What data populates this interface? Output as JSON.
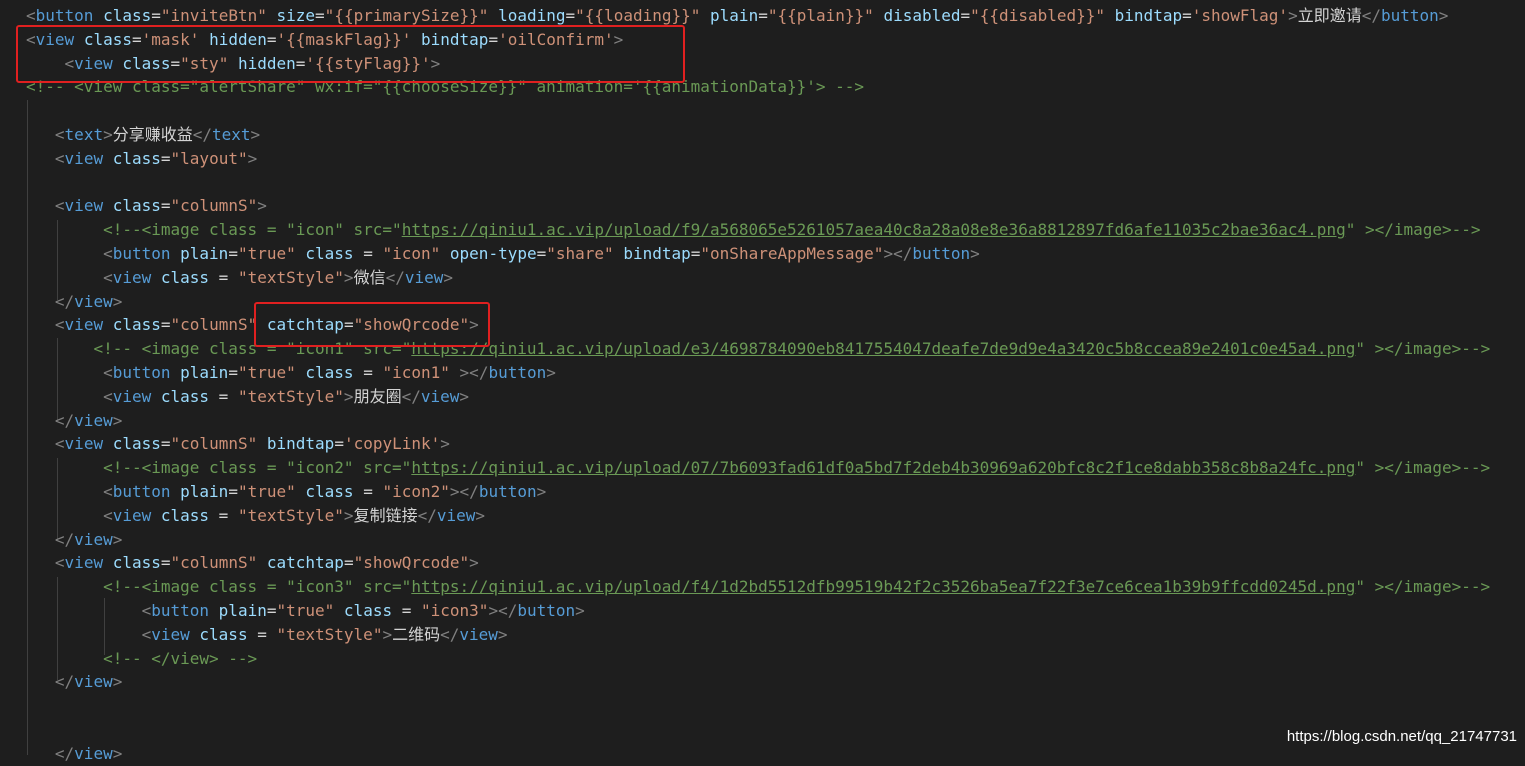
{
  "editor": {
    "theme": "dark",
    "background": "#1e1e1e",
    "lines": [
      [
        [
          "t-pun",
          "<"
        ],
        [
          "t-tag",
          "button"
        ],
        [
          "t-txt",
          " "
        ],
        [
          "t-attr",
          "class"
        ],
        [
          "t-txt",
          "="
        ],
        [
          "t-str",
          "\"inviteBtn\""
        ],
        [
          "t-txt",
          " "
        ],
        [
          "t-attr",
          "size"
        ],
        [
          "t-txt",
          "="
        ],
        [
          "t-str",
          "\"{{primarySize}}\""
        ],
        [
          "t-txt",
          " "
        ],
        [
          "t-attr",
          "loading"
        ],
        [
          "t-txt",
          "="
        ],
        [
          "t-str",
          "\"{{loading}}\""
        ],
        [
          "t-txt",
          " "
        ],
        [
          "t-attr",
          "plain"
        ],
        [
          "t-txt",
          "="
        ],
        [
          "t-str",
          "\"{{plain}}\""
        ],
        [
          "t-txt",
          " "
        ],
        [
          "t-attr",
          "disabled"
        ],
        [
          "t-txt",
          "="
        ],
        [
          "t-str",
          "\"{{disabled}}\""
        ],
        [
          "t-txt",
          " "
        ],
        [
          "t-attr",
          "bindtap"
        ],
        [
          "t-txt",
          "="
        ],
        [
          "t-str",
          "'showFlag'"
        ],
        [
          "t-pun",
          ">"
        ],
        [
          "t-txt",
          "立即邀请"
        ],
        [
          "t-pun",
          "</"
        ],
        [
          "t-tag",
          "button"
        ],
        [
          "t-pun",
          ">"
        ]
      ],
      [
        [
          "t-pun",
          "<"
        ],
        [
          "t-tag",
          "view"
        ],
        [
          "t-txt",
          " "
        ],
        [
          "t-attr",
          "class"
        ],
        [
          "t-txt",
          "="
        ],
        [
          "t-str",
          "'mask'"
        ],
        [
          "t-txt",
          " "
        ],
        [
          "t-attr",
          "hidden"
        ],
        [
          "t-txt",
          "="
        ],
        [
          "t-str",
          "'{{maskFlag}}'"
        ],
        [
          "t-txt",
          " "
        ],
        [
          "t-attr",
          "bindtap"
        ],
        [
          "t-txt",
          "="
        ],
        [
          "t-str",
          "'oilConfirm'"
        ],
        [
          "t-pun",
          ">"
        ]
      ],
      [
        [
          "t-txt",
          "    "
        ],
        [
          "t-pun",
          "<"
        ],
        [
          "t-tag",
          "view"
        ],
        [
          "t-txt",
          " "
        ],
        [
          "t-attr",
          "class"
        ],
        [
          "t-txt",
          "="
        ],
        [
          "t-str",
          "\"sty\""
        ],
        [
          "t-txt",
          " "
        ],
        [
          "t-attr",
          "hidden"
        ],
        [
          "t-txt",
          "="
        ],
        [
          "t-str",
          "'{{styFlag}}'"
        ],
        [
          "t-pun",
          ">"
        ]
      ],
      [
        [
          "t-cm",
          "<!-- <view class=\"alertShare\" wx:if=\"{{chooseSize}}\" animation='{{animationData}}'> -->"
        ]
      ],
      [],
      [
        [
          "t-txt",
          "   "
        ],
        [
          "t-pun",
          "<"
        ],
        [
          "t-tag",
          "text"
        ],
        [
          "t-pun",
          ">"
        ],
        [
          "t-txt",
          "分享赚收益"
        ],
        [
          "t-pun",
          "</"
        ],
        [
          "t-tag",
          "text"
        ],
        [
          "t-pun",
          ">"
        ]
      ],
      [
        [
          "t-txt",
          "   "
        ],
        [
          "t-pun",
          "<"
        ],
        [
          "t-tag",
          "view"
        ],
        [
          "t-txt",
          " "
        ],
        [
          "t-attr",
          "class"
        ],
        [
          "t-txt",
          "="
        ],
        [
          "t-str",
          "\"layout\""
        ],
        [
          "t-pun",
          ">"
        ]
      ],
      [],
      [
        [
          "t-txt",
          "   "
        ],
        [
          "t-pun",
          "<"
        ],
        [
          "t-tag",
          "view"
        ],
        [
          "t-txt",
          " "
        ],
        [
          "t-attr",
          "class"
        ],
        [
          "t-txt",
          "="
        ],
        [
          "t-str",
          "\"columnS\""
        ],
        [
          "t-pun",
          ">"
        ]
      ],
      [
        [
          "t-txt",
          "        "
        ],
        [
          "t-cm",
          "<!--<image class = \"icon\" src=\""
        ],
        [
          "t-cm-url",
          "https://qiniu1.ac.vip/upload/f9/a568065e5261057aea40c8a28a08e8e36a8812897fd6afe11035c2bae36ac4.png"
        ],
        [
          "t-cm",
          "\" ></image>-->"
        ]
      ],
      [
        [
          "t-txt",
          "        "
        ],
        [
          "t-pun",
          "<"
        ],
        [
          "t-tag",
          "button"
        ],
        [
          "t-txt",
          " "
        ],
        [
          "t-attr",
          "plain"
        ],
        [
          "t-txt",
          "="
        ],
        [
          "t-str",
          "\"true\""
        ],
        [
          "t-txt",
          " "
        ],
        [
          "t-attr",
          "class"
        ],
        [
          "t-txt",
          " = "
        ],
        [
          "t-str",
          "\"icon\""
        ],
        [
          "t-txt",
          " "
        ],
        [
          "t-attr",
          "open-type"
        ],
        [
          "t-txt",
          "="
        ],
        [
          "t-str",
          "\"share\""
        ],
        [
          "t-txt",
          " "
        ],
        [
          "t-attr",
          "bindtap"
        ],
        [
          "t-txt",
          "="
        ],
        [
          "t-str",
          "\"onShareAppMessage\""
        ],
        [
          "t-pun",
          "></"
        ],
        [
          "t-tag",
          "button"
        ],
        [
          "t-pun",
          ">"
        ]
      ],
      [
        [
          "t-txt",
          "        "
        ],
        [
          "t-pun",
          "<"
        ],
        [
          "t-tag",
          "view"
        ],
        [
          "t-txt",
          " "
        ],
        [
          "t-attr",
          "class"
        ],
        [
          "t-txt",
          " = "
        ],
        [
          "t-str",
          "\"textStyle\""
        ],
        [
          "t-pun",
          ">"
        ],
        [
          "t-txt",
          "微信"
        ],
        [
          "t-pun",
          "</"
        ],
        [
          "t-tag",
          "view"
        ],
        [
          "t-pun",
          ">"
        ]
      ],
      [
        [
          "t-txt",
          "   "
        ],
        [
          "t-pun",
          "</"
        ],
        [
          "t-tag",
          "view"
        ],
        [
          "t-pun",
          ">"
        ]
      ],
      [
        [
          "t-txt",
          "   "
        ],
        [
          "t-pun",
          "<"
        ],
        [
          "t-tag",
          "view"
        ],
        [
          "t-txt",
          " "
        ],
        [
          "t-attr",
          "class"
        ],
        [
          "t-txt",
          "="
        ],
        [
          "t-str",
          "\"columnS\""
        ],
        [
          "t-txt",
          " "
        ],
        [
          "t-attr",
          "catchtap"
        ],
        [
          "t-txt",
          "="
        ],
        [
          "t-str",
          "\"showQrcode\""
        ],
        [
          "t-pun",
          ">"
        ]
      ],
      [
        [
          "t-txt",
          "       "
        ],
        [
          "t-cm",
          "<!-- <image class = \"icon1\" src=\""
        ],
        [
          "t-cm-url",
          "https://qiniu1.ac.vip/upload/e3/4698784090eb8417554047deafe7de9d9e4a3420c5b8ccea89e2401c0e45a4.png"
        ],
        [
          "t-cm",
          "\" ></image>-->"
        ]
      ],
      [
        [
          "t-txt",
          "        "
        ],
        [
          "t-pun",
          "<"
        ],
        [
          "t-tag",
          "button"
        ],
        [
          "t-txt",
          " "
        ],
        [
          "t-attr",
          "plain"
        ],
        [
          "t-txt",
          "="
        ],
        [
          "t-str",
          "\"true\""
        ],
        [
          "t-txt",
          " "
        ],
        [
          "t-attr",
          "class"
        ],
        [
          "t-txt",
          " = "
        ],
        [
          "t-str",
          "\"icon1\""
        ],
        [
          "t-txt",
          " "
        ],
        [
          "t-pun",
          "></"
        ],
        [
          "t-tag",
          "button"
        ],
        [
          "t-pun",
          ">"
        ]
      ],
      [
        [
          "t-txt",
          "        "
        ],
        [
          "t-pun",
          "<"
        ],
        [
          "t-tag",
          "view"
        ],
        [
          "t-txt",
          " "
        ],
        [
          "t-attr",
          "class"
        ],
        [
          "t-txt",
          " = "
        ],
        [
          "t-str",
          "\"textStyle\""
        ],
        [
          "t-pun",
          ">"
        ],
        [
          "t-txt",
          "朋友圈"
        ],
        [
          "t-pun",
          "</"
        ],
        [
          "t-tag",
          "view"
        ],
        [
          "t-pun",
          ">"
        ]
      ],
      [
        [
          "t-txt",
          "   "
        ],
        [
          "t-pun",
          "</"
        ],
        [
          "t-tag",
          "view"
        ],
        [
          "t-pun",
          ">"
        ]
      ],
      [
        [
          "t-txt",
          "   "
        ],
        [
          "t-pun",
          "<"
        ],
        [
          "t-tag",
          "view"
        ],
        [
          "t-txt",
          " "
        ],
        [
          "t-attr",
          "class"
        ],
        [
          "t-txt",
          "="
        ],
        [
          "t-str",
          "\"columnS\""
        ],
        [
          "t-txt",
          " "
        ],
        [
          "t-attr",
          "bindtap"
        ],
        [
          "t-txt",
          "="
        ],
        [
          "t-str",
          "'copyLink'"
        ],
        [
          "t-pun",
          ">"
        ]
      ],
      [
        [
          "t-txt",
          "        "
        ],
        [
          "t-cm",
          "<!--<image class = \"icon2\" src=\""
        ],
        [
          "t-cm-url",
          "https://qiniu1.ac.vip/upload/07/7b6093fad61df0a5bd7f2deb4b30969a620bfc8c2f1ce8dabb358c8b8a24fc.png"
        ],
        [
          "t-cm",
          "\" ></image>-->"
        ]
      ],
      [
        [
          "t-txt",
          "        "
        ],
        [
          "t-pun",
          "<"
        ],
        [
          "t-tag",
          "button"
        ],
        [
          "t-txt",
          " "
        ],
        [
          "t-attr",
          "plain"
        ],
        [
          "t-txt",
          "="
        ],
        [
          "t-str",
          "\"true\""
        ],
        [
          "t-txt",
          " "
        ],
        [
          "t-attr",
          "class"
        ],
        [
          "t-txt",
          " = "
        ],
        [
          "t-str",
          "\"icon2\""
        ],
        [
          "t-pun",
          "></"
        ],
        [
          "t-tag",
          "button"
        ],
        [
          "t-pun",
          ">"
        ]
      ],
      [
        [
          "t-txt",
          "        "
        ],
        [
          "t-pun",
          "<"
        ],
        [
          "t-tag",
          "view"
        ],
        [
          "t-txt",
          " "
        ],
        [
          "t-attr",
          "class"
        ],
        [
          "t-txt",
          " = "
        ],
        [
          "t-str",
          "\"textStyle\""
        ],
        [
          "t-pun",
          ">"
        ],
        [
          "t-txt",
          "复制链接"
        ],
        [
          "t-pun",
          "</"
        ],
        [
          "t-tag",
          "view"
        ],
        [
          "t-pun",
          ">"
        ]
      ],
      [
        [
          "t-txt",
          "   "
        ],
        [
          "t-pun",
          "</"
        ],
        [
          "t-tag",
          "view"
        ],
        [
          "t-pun",
          ">"
        ]
      ],
      [
        [
          "t-txt",
          "   "
        ],
        [
          "t-pun",
          "<"
        ],
        [
          "t-tag",
          "view"
        ],
        [
          "t-txt",
          " "
        ],
        [
          "t-attr",
          "class"
        ],
        [
          "t-txt",
          "="
        ],
        [
          "t-str",
          "\"columnS\""
        ],
        [
          "t-txt",
          " "
        ],
        [
          "t-attr",
          "catchtap"
        ],
        [
          "t-txt",
          "="
        ],
        [
          "t-str",
          "\"showQrcode\""
        ],
        [
          "t-pun",
          ">"
        ]
      ],
      [
        [
          "t-txt",
          "        "
        ],
        [
          "t-cm",
          "<!--<image class = \"icon3\" src=\""
        ],
        [
          "t-cm-url",
          "https://qiniu1.ac.vip/upload/f4/1d2bd5512dfb99519b42f2c3526ba5ea7f22f3e7ce6cea1b39b9ffcdd0245d.png"
        ],
        [
          "t-cm",
          "\" ></image>-->"
        ]
      ],
      [
        [
          "t-txt",
          "            "
        ],
        [
          "t-pun",
          "<"
        ],
        [
          "t-tag",
          "button"
        ],
        [
          "t-txt",
          " "
        ],
        [
          "t-attr",
          "plain"
        ],
        [
          "t-txt",
          "="
        ],
        [
          "t-str",
          "\"true\""
        ],
        [
          "t-txt",
          " "
        ],
        [
          "t-attr",
          "class"
        ],
        [
          "t-txt",
          " = "
        ],
        [
          "t-str",
          "\"icon3\""
        ],
        [
          "t-pun",
          "></"
        ],
        [
          "t-tag",
          "button"
        ],
        [
          "t-pun",
          ">"
        ]
      ],
      [
        [
          "t-txt",
          "            "
        ],
        [
          "t-pun",
          "<"
        ],
        [
          "t-tag",
          "view"
        ],
        [
          "t-txt",
          " "
        ],
        [
          "t-attr",
          "class"
        ],
        [
          "t-txt",
          " = "
        ],
        [
          "t-str",
          "\"textStyle\""
        ],
        [
          "t-pun",
          ">"
        ],
        [
          "t-txt",
          "二维码"
        ],
        [
          "t-pun",
          "</"
        ],
        [
          "t-tag",
          "view"
        ],
        [
          "t-pun",
          ">"
        ]
      ],
      [
        [
          "t-txt",
          "        "
        ],
        [
          "t-cm",
          "<!-- </view> -->"
        ]
      ],
      [
        [
          "t-txt",
          "   "
        ],
        [
          "t-pun",
          "</"
        ],
        [
          "t-tag",
          "view"
        ],
        [
          "t-pun",
          ">"
        ]
      ],
      [],
      [],
      [
        [
          "t-txt",
          "   "
        ],
        [
          "t-pun",
          "</"
        ],
        [
          "t-tag",
          "view"
        ],
        [
          "t-pun",
          ">"
        ]
      ]
    ]
  },
  "highlights": [
    {
      "name": "highlight-mask-view"
    },
    {
      "name": "highlight-catchtap-attr"
    }
  ],
  "highlight_color": "#e02020",
  "watermark": "https://blog.csdn.net/qq_21747731"
}
